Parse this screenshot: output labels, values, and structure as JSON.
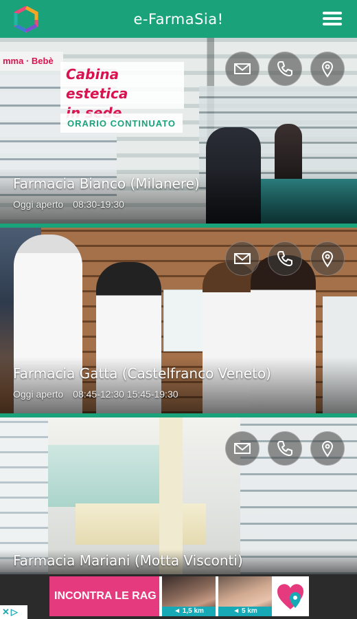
{
  "header": {
    "title": "e-FarmaSia!",
    "logo_icon": "hexagon-logo-icon",
    "menu_icon": "hamburger-menu-icon"
  },
  "cards": [
    {
      "name": "Farmacia Bianco (Milanere)",
      "status": "Oggi aperto",
      "hours": "08:30-19:30",
      "promo_line1": "Cabina estetica",
      "promo_line2": "in sede",
      "promo_banner": "ORARIO CONTINUATO",
      "store_sign": "mma · Bebè"
    },
    {
      "name": "Farmacia Gatta (Castelfranco Veneto)",
      "status": "Oggi aperto",
      "hours": "08:45-12:30 15:45-19:30"
    },
    {
      "name": "Farmacia Mariani (Motta Visconti)",
      "status": "",
      "hours": ""
    }
  ],
  "actions": {
    "mail_icon": "envelope-icon",
    "phone_icon": "phone-icon",
    "map_icon": "map-pin-icon"
  },
  "ad": {
    "text": "INCONTRA LE RAG",
    "distance1": "◄ 1,5 km",
    "distance2": "◄ 5 km",
    "close_label": "✕",
    "info_label": "▷"
  },
  "colors": {
    "accent": "#1aa37a",
    "promo": "#d8134f",
    "ad_pink": "#e63a7e",
    "ad_teal": "#18a9b7"
  }
}
